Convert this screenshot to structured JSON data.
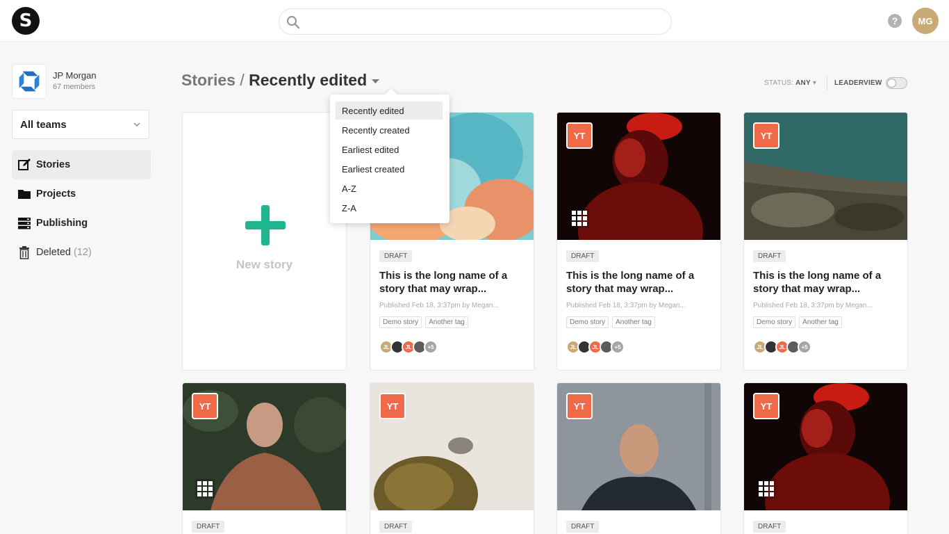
{
  "app": {
    "logo_letter": "S",
    "search": {
      "placeholder": "",
      "value": ""
    },
    "help_label": "?",
    "user_initials": "MG",
    "colors": {
      "accent": "#1fb58f",
      "yt_badge": "#ee6a48",
      "avatar_top": "#c9aa75",
      "org_logo": "#1f6fc2"
    }
  },
  "sidebar": {
    "org": {
      "name": "JP Morgan",
      "members": "67 members"
    },
    "teams_select": "All teams",
    "nav": [
      {
        "label": "Stories",
        "icon": "edit-icon",
        "active": true
      },
      {
        "label": "Projects",
        "icon": "folder-icon"
      },
      {
        "label": "Publishing",
        "icon": "server-icon"
      },
      {
        "label": "Deleted",
        "count": "(12)",
        "icon": "trash-icon"
      }
    ]
  },
  "header": {
    "root": "Stories",
    "separator": "/",
    "current": "Recently edited",
    "status_label": "STATUS:",
    "status_value": "ANY",
    "leaderview_label": "LEADERVIEW",
    "leaderview_on": false
  },
  "sort_menu": {
    "items": [
      "Recently edited",
      "Recently created",
      "Earliest edited",
      "Earliest created",
      "A-Z",
      "Z-A"
    ],
    "selected": "Recently edited"
  },
  "new_story_label": "New story",
  "cards": [
    {
      "status": "DRAFT",
      "title": "This is the long name of a story that may wrap...",
      "meta": "Published Feb 18, 3:37pm by Megan...",
      "tags": [
        "Demo story",
        "Another tag"
      ],
      "contributors": [
        "JL",
        "",
        "JL",
        "",
        "+5"
      ]
    },
    {
      "badge": "YT",
      "status": "DRAFT",
      "title": "This is the long name of a story that may wrap...",
      "meta": "Published Feb 18, 3:37pm by Megan...",
      "tags": [
        "Demo story",
        "Another tag"
      ],
      "contributors": [
        "JL",
        "",
        "JL",
        "",
        "+5"
      ]
    },
    {
      "badge": "YT",
      "status": "DRAFT",
      "title": "This is the long name of a story that may wrap...",
      "meta": "Published Feb 18, 3:37pm by Megan...",
      "tags": [
        "Demo story",
        "Another tag"
      ],
      "contributors": [
        "JL",
        "",
        "JL",
        "",
        "+5"
      ]
    },
    {
      "badge": "YT",
      "status": "DRAFT"
    },
    {
      "badge": "YT",
      "status": "DRAFT"
    },
    {
      "badge": "YT",
      "status": "DRAFT"
    },
    {
      "badge": "YT",
      "status": "DRAFT"
    }
  ]
}
